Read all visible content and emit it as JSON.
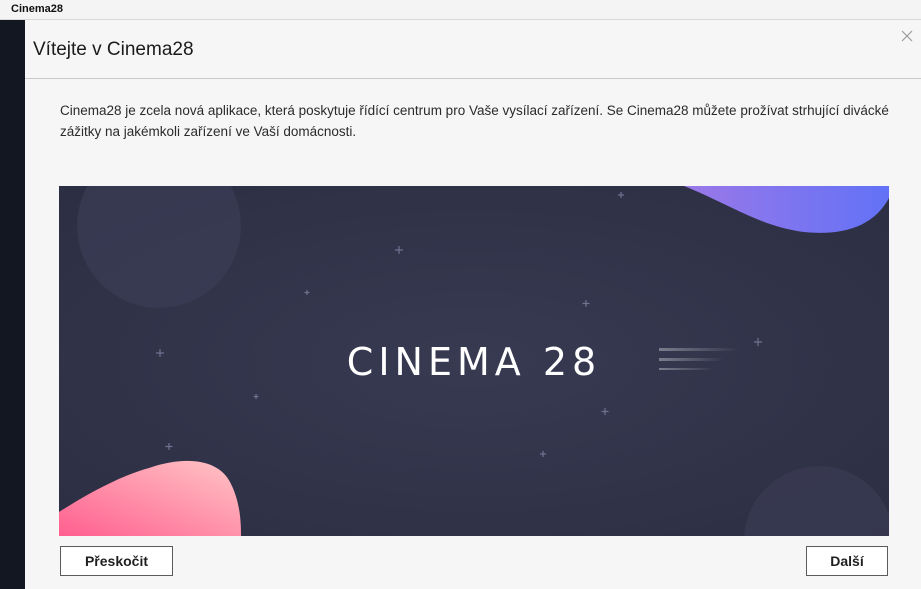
{
  "app": {
    "title": "Cinema28"
  },
  "dialog": {
    "title": "Vítejte v Cinema28",
    "close_icon": "close-icon",
    "description": "Cinema28 je zcela nová aplikace, která poskytuje řídící centrum pro Vaše vysílací zařízení. Se Cinema28 můžete prožívat strhující divácké zážitky na jakémkoli zařízení ve Vaší domácnosti.",
    "hero": {
      "logo_text": "CINEMA 28",
      "colors": {
        "background": "#31334a",
        "accent_top": "#7b6cf2",
        "accent_bottom": "#ff7aa3"
      }
    },
    "buttons": {
      "skip": "Přeskočit",
      "next": "Další"
    }
  }
}
